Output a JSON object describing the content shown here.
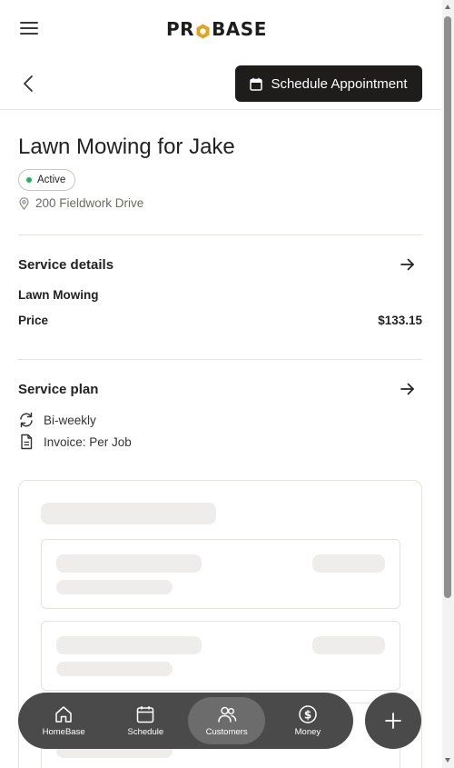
{
  "header": {
    "logo_pre": "PR",
    "logo_post": "BASE",
    "schedule_label": "Schedule Appointment"
  },
  "job": {
    "title": "Lawn Mowing for Jake",
    "status": "Active",
    "address": "200 Fieldwork Drive"
  },
  "service_details": {
    "title": "Service details",
    "service_name": "Lawn Mowing",
    "price_label": "Price",
    "price_value": "$133.15"
  },
  "service_plan": {
    "title": "Service plan",
    "frequency": "Bi-weekly",
    "invoice": "Invoice: Per Job"
  },
  "nav": {
    "items": [
      {
        "label": "HomeBase",
        "icon": "home-icon"
      },
      {
        "label": "Schedule",
        "icon": "calendar-icon"
      },
      {
        "label": "Customers",
        "icon": "users-icon"
      },
      {
        "label": "Money",
        "icon": "dollar-icon"
      }
    ],
    "active": "Customers"
  },
  "colors": {
    "primary_dark": "#1f1d1b",
    "logo_accent": "#e3a21a",
    "status_green": "#22b455",
    "nav_bg": "#4a4a4a"
  }
}
